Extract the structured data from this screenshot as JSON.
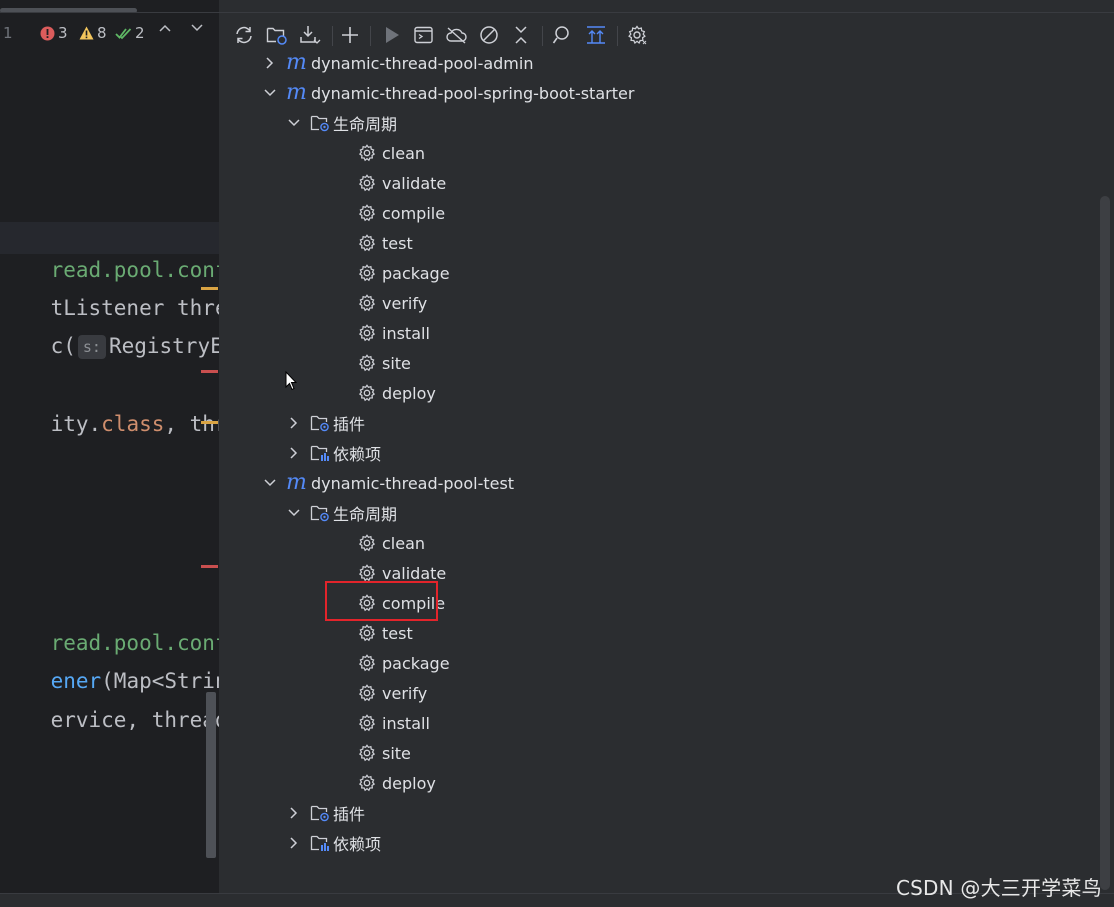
{
  "editor": {
    "top_line_number": "1",
    "error_count": "3",
    "warning_count": "8",
    "ok_count": "2",
    "param_hint": "s:",
    "lines": [
      {
        "segments": [
          {
            "t": "read.pool.config",
            "c": "c-green"
          }
        ]
      },
      {
        "segments": [
          {
            "t": "tListener thread",
            "c": "c-default"
          }
        ]
      },
      {
        "segments": [
          {
            "t": "c(",
            "c": "c-default"
          }
        ],
        "hint_then": "RegistryEnum"
      },
      {
        "segments": [
          {
            "t": "ity.",
            "c": "c-default"
          },
          {
            "t": "class",
            "c": "c-orange"
          },
          {
            "t": ", threa",
            "c": "c-default"
          }
        ]
      },
      {
        "segments": [
          {
            "t": "read.pool.config",
            "c": "c-green"
          }
        ]
      },
      {
        "segments": [
          {
            "t": "ener",
            "c": "c-blue"
          },
          {
            "t": "(Map<String,",
            "c": "c-default"
          }
        ]
      },
      {
        "segments": [
          {
            "t": "ervice, threadPo",
            "c": "c-default"
          }
        ]
      }
    ]
  },
  "maven": {
    "tree": [
      {
        "label": "dynamic-thread-pool-admin",
        "kind": "module",
        "expanded": false
      },
      {
        "label": "dynamic-thread-pool-spring-boot-starter",
        "kind": "module",
        "expanded": true
      },
      {
        "label": "生命周期",
        "kind": "folder",
        "expanded": true
      },
      {
        "label": "clean",
        "kind": "goal"
      },
      {
        "label": "validate",
        "kind": "goal"
      },
      {
        "label": "compile",
        "kind": "goal"
      },
      {
        "label": "test",
        "kind": "goal"
      },
      {
        "label": "package",
        "kind": "goal"
      },
      {
        "label": "verify",
        "kind": "goal"
      },
      {
        "label": "install",
        "kind": "goal"
      },
      {
        "label": "site",
        "kind": "goal"
      },
      {
        "label": "deploy",
        "kind": "goal"
      },
      {
        "label": "插件",
        "kind": "folder",
        "expanded": false
      },
      {
        "label": "依赖项",
        "kind": "deps",
        "expanded": false
      },
      {
        "label": "dynamic-thread-pool-test",
        "kind": "module",
        "expanded": true
      },
      {
        "label": "生命周期",
        "kind": "folder",
        "expanded": true
      },
      {
        "label": "clean",
        "kind": "goal"
      },
      {
        "label": "validate",
        "kind": "goal"
      },
      {
        "label": "compile",
        "kind": "goal",
        "highlighted": true
      },
      {
        "label": "test",
        "kind": "goal"
      },
      {
        "label": "package",
        "kind": "goal"
      },
      {
        "label": "verify",
        "kind": "goal"
      },
      {
        "label": "install",
        "kind": "goal"
      },
      {
        "label": "site",
        "kind": "goal"
      },
      {
        "label": "deploy",
        "kind": "goal"
      },
      {
        "label": "插件",
        "kind": "folder",
        "expanded": false
      },
      {
        "label": "依赖项",
        "kind": "deps",
        "expanded": false
      }
    ]
  },
  "watermark": "CSDN @大三开学菜鸟",
  "colors": {
    "accent_blue": "#548af7",
    "highlight_box": "#e3242b",
    "error_red": "#db5c5c",
    "warning_yellow": "#f2c55c",
    "ok_green": "#5fb865"
  }
}
